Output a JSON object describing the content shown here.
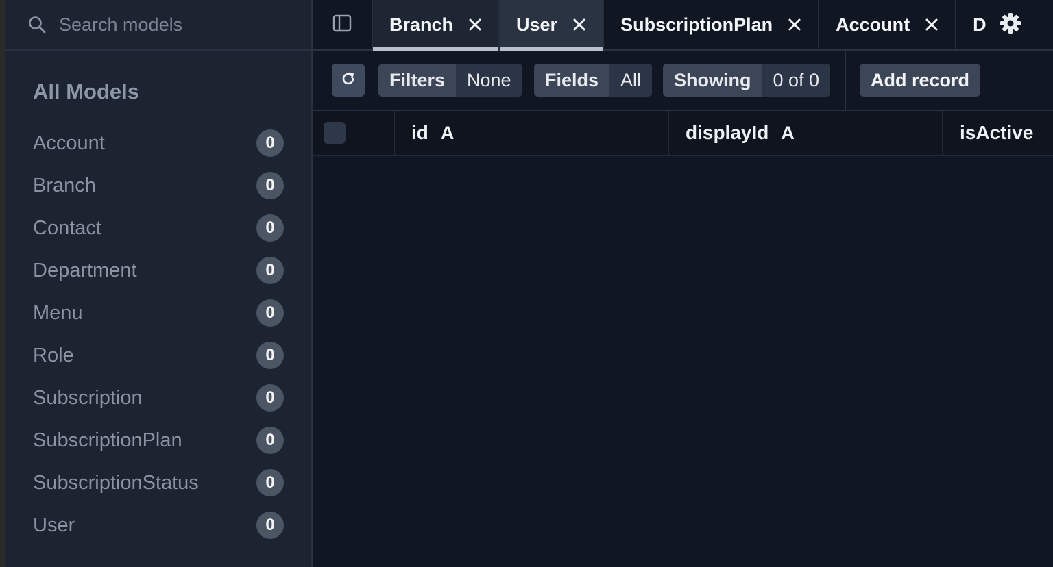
{
  "search": {
    "placeholder": "Search models"
  },
  "sidebar": {
    "title": "All Models",
    "items": [
      {
        "label": "Account",
        "count": "0"
      },
      {
        "label": "Branch",
        "count": "0"
      },
      {
        "label": "Contact",
        "count": "0"
      },
      {
        "label": "Department",
        "count": "0"
      },
      {
        "label": "Menu",
        "count": "0"
      },
      {
        "label": "Role",
        "count": "0"
      },
      {
        "label": "Subscription",
        "count": "0"
      },
      {
        "label": "SubscriptionPlan",
        "count": "0"
      },
      {
        "label": "SubscriptionStatus",
        "count": "0"
      },
      {
        "label": "User",
        "count": "0"
      }
    ]
  },
  "tabs": [
    {
      "label": "Branch",
      "state": "active"
    },
    {
      "label": "User",
      "state": "selected"
    },
    {
      "label": "SubscriptionPlan",
      "state": "normal"
    },
    {
      "label": "Account",
      "state": "normal"
    }
  ],
  "tab_partial": "D",
  "toolbar": {
    "filters_label": "Filters",
    "filters_value": "None",
    "fields_label": "Fields",
    "fields_value": "All",
    "showing_label": "Showing",
    "showing_value": "0 of 0",
    "add_record": "Add record"
  },
  "columns": [
    {
      "name": "id",
      "type": "A"
    },
    {
      "name": "displayId",
      "type": "A"
    },
    {
      "name": "isActive",
      "type": ""
    }
  ],
  "colors": {
    "background": "#111722",
    "sidebar": "#1c2331",
    "badge": "#4b5563",
    "active_tab_underline": "#b8c0cd"
  },
  "icons": {
    "search": "search-icon",
    "sidebar_toggle": "sidebar-toggle-icon",
    "close": "close-icon",
    "settings": "gear-icon",
    "refresh": "refresh-icon"
  }
}
